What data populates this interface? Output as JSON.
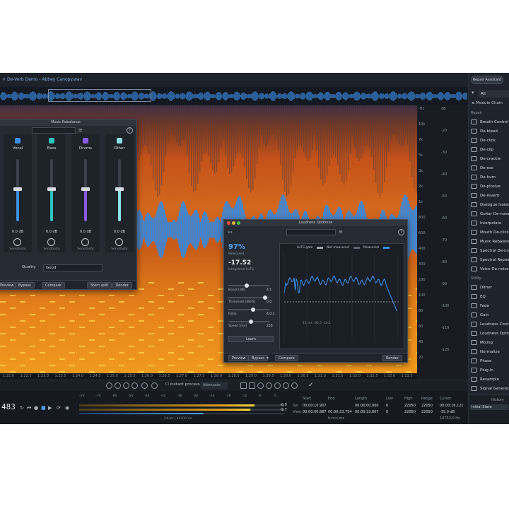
{
  "header": {
    "file_tab": "De-Verb Demo - Abbey Canopy.wav"
  },
  "right_panel": {
    "repair_assistant": "Repair Assistant",
    "filter": "All",
    "module_chain": "Module Chain",
    "repair_section": "Repair",
    "repair_modules": [
      "Breath Control",
      "De-bleed",
      "De-click",
      "De-clip",
      "De-crackle",
      "De-ess",
      "De-hum",
      "De-plosive",
      "De-reverb",
      "Dialogue Isolate",
      "Guitar De-noise",
      "Interpolate",
      "Mouth De-click",
      "Music Rebalance",
      "Spectral De-noise",
      "Spectral Repair",
      "Voice De-noise"
    ],
    "utility_section": "Utility",
    "utility_modules": [
      "Dither",
      "EQ",
      "Fade",
      "Gain",
      "Loudness Control",
      "Loudness Optimize",
      "Mixing",
      "Normalize",
      "Phase",
      "Plug-in",
      "Resample",
      "Signal Generator"
    ],
    "history_title": "History",
    "history_item": "Initial State"
  },
  "spectrogram": {
    "freq_ticks": [
      "-Hz",
      "10k",
      "7k",
      "5k",
      "3k",
      "2k",
      "1k",
      "800",
      "600",
      "400",
      "300",
      "200",
      "100",
      "80",
      "60",
      "40",
      "20"
    ],
    "db_ticks": [
      "dB",
      "-20",
      "-30",
      "-40",
      "-50",
      "-60",
      "-70",
      "-80",
      "-90",
      "-100",
      "-110",
      "-120"
    ],
    "time_ticks": [
      "1:22.0",
      "1:22.5",
      "1:23.0",
      "1:23.5",
      "1:24.0",
      "1:24.5",
      "1:25.0",
      "1:25.5",
      "1:26.0",
      "1:26.5",
      "1:27.0",
      "1:27.5",
      "1:28.0",
      "1:28.5",
      "1:29.0",
      "1:29.5",
      "1:30.0",
      "1:30.5",
      "1:31.0",
      "1:31.5",
      "1:32.0",
      "1:32.5",
      "1:33.0",
      "1:33.5"
    ]
  },
  "toolbar": {
    "instant_process": "Instant process",
    "attenuate": "Attenuate"
  },
  "transport": {
    "timecode": "483",
    "meter_scale": [
      "-Inf",
      "-70",
      "-60",
      "-54",
      "-48",
      "-42",
      "-36",
      "-30",
      "-24",
      "-18",
      "-12",
      "-6",
      "0"
    ],
    "meter_readout_1": "-8.9",
    "meter_readout_2": "-9.7",
    "format": "24-bit | 44100 Hz",
    "selection": {
      "headers": [
        "Start",
        "End",
        "Length",
        "Low",
        "High",
        "Range",
        "Cursor"
      ],
      "sel_label": "Sel",
      "view_label": "View",
      "sel_values": [
        "00:00:10.907",
        "",
        "00:00:00.000",
        "0",
        "22050",
        "22050",
        "00:00:16.121"
      ],
      "view_values": [
        "00:00:00.887",
        "00:00:23.754",
        "00:00:22.867",
        "0",
        "22050",
        "22050",
        "-35.0 dB"
      ],
      "footer_1": "h:m:s.ms",
      "footer_2": "10752.0 Hz"
    }
  },
  "music_rebalance": {
    "title": "Music Rebalance",
    "stems": [
      {
        "name": "Vocal",
        "gain": "0.0 dB",
        "sensitivity": "Sensitivity",
        "color": "#3b8ee8",
        "level": 0.52
      },
      {
        "name": "Bass",
        "gain": "0.0 dB",
        "sensitivity": "Sensitivity",
        "color": "#2ec4c0",
        "level": 0.52
      },
      {
        "name": "Drums",
        "gain": "0.0 dB",
        "sensitivity": "Sensitivity",
        "color": "#8a5ce6",
        "level": 0.52
      },
      {
        "name": "Other",
        "gain": "0.0 dB",
        "sensitivity": "Sensitivity",
        "color": "#8ee0e6",
        "level": 0.52
      }
    ],
    "quality_label": "Quality",
    "quality": "Good",
    "buttons": {
      "preview": "Preview",
      "bypass": "Bypass",
      "compare": "Compare",
      "stem_split": "Stem split",
      "render": "Render"
    }
  },
  "loudness_optimize": {
    "title": "Loudness Optimize",
    "measured_pct": "97%",
    "measured_label": "Measured",
    "integrated": "-17.52",
    "integrated_label": "Integrated LUFS",
    "params": [
      {
        "name": "Boost [dB]",
        "value": "4.1",
        "pos": 0.45
      },
      {
        "name": "Threshold [dBFS]",
        "value": "0.0",
        "pos": 0.95
      },
      {
        "name": "Ratio",
        "value": "4.0:1",
        "pos": 0.62
      },
      {
        "name": "Speed [ms]",
        "value": "250",
        "pos": 0.55
      }
    ],
    "learn": "Learn",
    "legend": {
      "gate": "LUFS gate",
      "not_measured": "Not measured",
      "measured": "Measured"
    },
    "graph_readout": "11 ms  -30.5  -14.1",
    "buttons": {
      "preview": "Preview",
      "bypass": "Bypass",
      "compare": "Compare",
      "render": "Render"
    }
  },
  "colors": {
    "accent": "#3b8ee8",
    "spectrum_orange": "#d9741a",
    "waveform_blue": "#2a8cf0",
    "panel_bg": "#262b33"
  }
}
